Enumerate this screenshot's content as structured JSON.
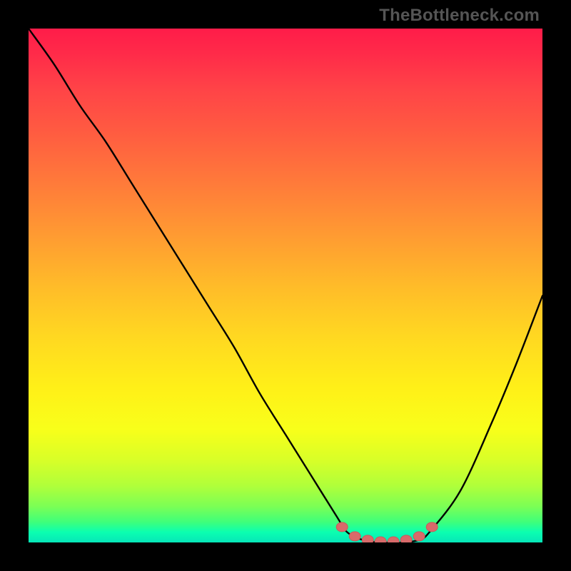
{
  "watermark": "TheBottleneck.com",
  "colors": {
    "black": "#000000",
    "curve": "#000000",
    "marker": "#d86a6a",
    "marker_stroke": "#c95a5a"
  },
  "chart_data": {
    "type": "line",
    "title": "",
    "xlabel": "",
    "ylabel": "",
    "xlim": [
      0,
      100
    ],
    "ylim": [
      0,
      100
    ],
    "grid": false,
    "legend": false,
    "series": [
      {
        "name": "bottleneck_curve",
        "x": [
          0,
          5,
          10,
          15,
          20,
          25,
          30,
          35,
          40,
          45,
          50,
          55,
          60,
          62,
          65,
          68,
          70,
          73,
          76,
          78,
          84,
          90,
          95,
          100
        ],
        "y": [
          100,
          93,
          85,
          78,
          70,
          62,
          54,
          46,
          38,
          29,
          21,
          13,
          5,
          2,
          0.5,
          0,
          0,
          0,
          0.5,
          2,
          10,
          23,
          35,
          48
        ]
      }
    ],
    "markers": {
      "name": "optimal_range",
      "x": [
        61,
        63.5,
        66,
        68.5,
        71,
        73.5,
        76,
        78.5
      ],
      "y": [
        3.0,
        1.2,
        0.5,
        0.2,
        0.2,
        0.5,
        1.2,
        3.0
      ]
    }
  }
}
